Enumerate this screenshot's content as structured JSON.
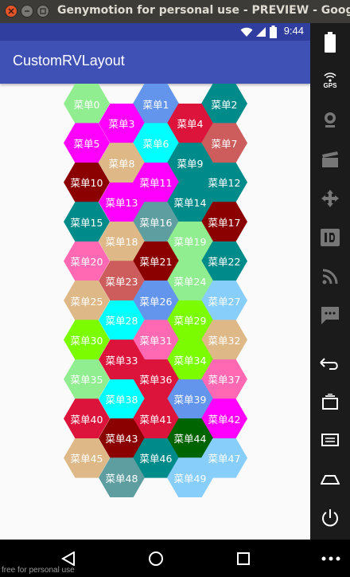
{
  "window": {
    "title": "Genymotion for personal use - PREVIEW - Google"
  },
  "status_bar": {
    "time": "9:44"
  },
  "app_bar": {
    "title": "CustomRVLayout"
  },
  "sidebar": {
    "gps_label": "GPS"
  },
  "watermark": "free for personal use",
  "colors": {
    "status_bar": "#303f9f",
    "app_bar": "#3f51b5"
  },
  "hexagons": [
    {
      "label": "菜单0",
      "color": "#90ee90"
    },
    {
      "label": "菜单1",
      "color": "#6495ed"
    },
    {
      "label": "菜单2",
      "color": "#008b8b"
    },
    {
      "label": "菜单3",
      "color": "#ff00ff"
    },
    {
      "label": "菜单4",
      "color": "#dc143c"
    },
    {
      "label": "菜单5",
      "color": "#ff00ff"
    },
    {
      "label": "菜单6",
      "color": "#00ffff"
    },
    {
      "label": "菜单7",
      "color": "#cd5c5c"
    },
    {
      "label": "菜单8",
      "color": "#deb887"
    },
    {
      "label": "菜单9",
      "color": "#008b8b"
    },
    {
      "label": "菜单10",
      "color": "#8b0000"
    },
    {
      "label": "菜单11",
      "color": "#ff00ff"
    },
    {
      "label": "菜单12",
      "color": "#008b8b"
    },
    {
      "label": "菜单13",
      "color": "#ff00ff"
    },
    {
      "label": "菜单14",
      "color": "#008b8b"
    },
    {
      "label": "菜单15",
      "color": "#008b8b"
    },
    {
      "label": "菜单16",
      "color": "#5f9ea0"
    },
    {
      "label": "菜单17",
      "color": "#8b0000"
    },
    {
      "label": "菜单18",
      "color": "#deb887"
    },
    {
      "label": "菜单19",
      "color": "#90ee90"
    },
    {
      "label": "菜单20",
      "color": "#ff69b4"
    },
    {
      "label": "菜单21",
      "color": "#8b0000"
    },
    {
      "label": "菜单22",
      "color": "#008b8b"
    },
    {
      "label": "菜单23",
      "color": "#cd5c5c"
    },
    {
      "label": "菜单24",
      "color": "#90ee90"
    },
    {
      "label": "菜单25",
      "color": "#deb887"
    },
    {
      "label": "菜单26",
      "color": "#6495ed"
    },
    {
      "label": "菜单27",
      "color": "#87cefa"
    },
    {
      "label": "菜单28",
      "color": "#00ffff"
    },
    {
      "label": "菜单29",
      "color": "#7cfc00"
    },
    {
      "label": "菜单30",
      "color": "#7cfc00"
    },
    {
      "label": "菜单31",
      "color": "#ff69b4"
    },
    {
      "label": "菜单32",
      "color": "#deb887"
    },
    {
      "label": "菜单33",
      "color": "#dc143c"
    },
    {
      "label": "菜单34",
      "color": "#7cfc00"
    },
    {
      "label": "菜单35",
      "color": "#90ee90"
    },
    {
      "label": "菜单36",
      "color": "#dc143c"
    },
    {
      "label": "菜单37",
      "color": "#ff69b4"
    },
    {
      "label": "菜单38",
      "color": "#00ffff"
    },
    {
      "label": "菜单39",
      "color": "#6495ed"
    },
    {
      "label": "菜单40",
      "color": "#dc143c"
    },
    {
      "label": "菜单41",
      "color": "#dc143c"
    },
    {
      "label": "菜单42",
      "color": "#ff00ff"
    },
    {
      "label": "菜单43",
      "color": "#8b0000"
    },
    {
      "label": "菜单44",
      "color": "#006400"
    },
    {
      "label": "菜单45",
      "color": "#deb887"
    },
    {
      "label": "菜单46",
      "color": "#008b8b"
    },
    {
      "label": "菜单47",
      "color": "#87cefa"
    },
    {
      "label": "菜单48",
      "color": "#5f9ea0"
    },
    {
      "label": "菜单49",
      "color": "#87cefa"
    }
  ]
}
